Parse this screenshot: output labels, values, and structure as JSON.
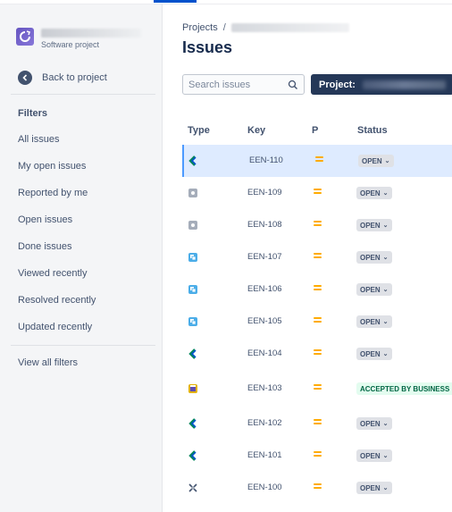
{
  "sidebar": {
    "project_type": "Software project",
    "back_label": "Back to project",
    "filters_title": "Filters",
    "items": [
      {
        "label": "All issues"
      },
      {
        "label": "My open issues"
      },
      {
        "label": "Reported by me"
      },
      {
        "label": "Open issues"
      },
      {
        "label": "Done issues"
      },
      {
        "label": "Viewed recently"
      },
      {
        "label": "Resolved recently"
      },
      {
        "label": "Updated recently"
      }
    ],
    "view_all": "View all filters"
  },
  "main": {
    "breadcrumb_root": "Projects",
    "breadcrumb_sep": "/",
    "title": "Issues",
    "search_placeholder": "Search issues",
    "project_filter_label": "Project:",
    "columns": {
      "type": "Type",
      "key": "Key",
      "priority": "P",
      "status": "Status"
    },
    "issues": [
      {
        "type": "epic",
        "key": "EEN-110",
        "status": "OPEN",
        "selected": true
      },
      {
        "type": "task",
        "key": "EEN-109",
        "status": "OPEN"
      },
      {
        "type": "task",
        "key": "EEN-108",
        "status": "OPEN"
      },
      {
        "type": "subtask",
        "key": "EEN-107",
        "status": "OPEN"
      },
      {
        "type": "subtask",
        "key": "EEN-106",
        "status": "OPEN"
      },
      {
        "type": "subtask",
        "key": "EEN-105",
        "status": "OPEN"
      },
      {
        "type": "epic",
        "key": "EEN-104",
        "status": "OPEN"
      },
      {
        "type": "request",
        "key": "EEN-103",
        "status": "ACCEPTED BY BUSINESS"
      },
      {
        "type": "epic",
        "key": "EEN-102",
        "status": "OPEN"
      },
      {
        "type": "epic",
        "key": "EEN-101",
        "status": "OPEN"
      },
      {
        "type": "bugtool",
        "key": "EEN-100",
        "status": "OPEN"
      }
    ]
  },
  "colors": {
    "accent": "#0052CC",
    "sidebar_bg": "#F4F5F7",
    "priority": "#FFAB00",
    "project_button": "#253858",
    "selected_row": "#DEEBFF",
    "status_green": "#006644"
  }
}
